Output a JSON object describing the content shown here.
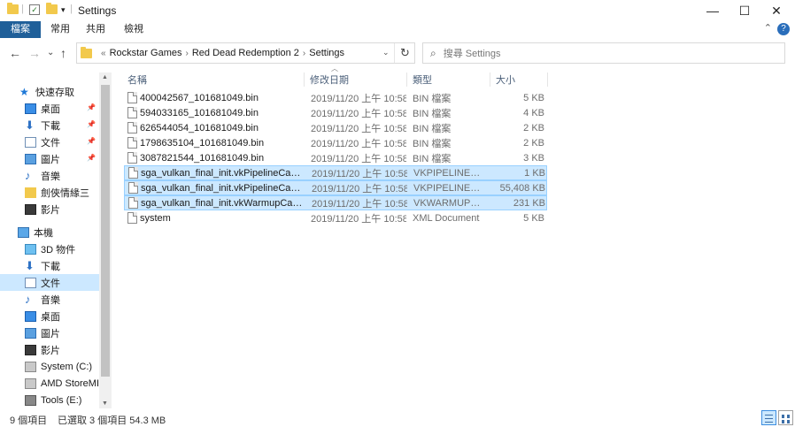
{
  "window": {
    "title": "Settings",
    "minimize": "—",
    "maximize": "☐",
    "close": "✕"
  },
  "ribbon": {
    "tabs": [
      "檔案",
      "常用",
      "共用",
      "檢視"
    ],
    "help": "?",
    "collapse": "⌃"
  },
  "address": {
    "overflow": "«",
    "crumbs": [
      "Rockstar Games",
      "Red Dead Redemption 2",
      "Settings"
    ],
    "separator": "›",
    "dropdown": "⌄",
    "refresh": "↻"
  },
  "search": {
    "placeholder": "搜尋 Settings"
  },
  "nav": {
    "back": "←",
    "forward": "→",
    "recent": "⌄",
    "up": "↑",
    "items": [
      {
        "label": "快速存取",
        "icon": "star-icon",
        "pinned": false
      },
      {
        "label": "桌面",
        "icon": "desktop-icon",
        "pinned": true
      },
      {
        "label": "下載",
        "icon": "download-icon",
        "pinned": true
      },
      {
        "label": "文件",
        "icon": "document-icon",
        "pinned": true
      },
      {
        "label": "圖片",
        "icon": "picture-icon",
        "pinned": true
      },
      {
        "label": "音樂",
        "icon": "music-icon",
        "pinned": false
      },
      {
        "label": "劍俠情緣三",
        "icon": "folder-icon",
        "pinned": false
      },
      {
        "label": "影片",
        "icon": "video-icon",
        "pinned": false
      },
      {
        "label": "本機",
        "icon": "computer-icon",
        "pinned": false
      },
      {
        "label": "3D 物件",
        "icon": "3d-objects-icon",
        "pinned": false
      },
      {
        "label": "下載",
        "icon": "download-icon",
        "pinned": false
      },
      {
        "label": "文件",
        "icon": "document-icon",
        "pinned": false
      },
      {
        "label": "音樂",
        "icon": "music-icon",
        "pinned": false
      },
      {
        "label": "桌面",
        "icon": "desktop-icon",
        "pinned": false
      },
      {
        "label": "圖片",
        "icon": "picture-icon",
        "pinned": false
      },
      {
        "label": "影片",
        "icon": "video-icon",
        "pinned": false
      },
      {
        "label": "System (C:)",
        "icon": "drive-icon",
        "pinned": false
      },
      {
        "label": "AMD StoreMI (",
        "icon": "drive-icon",
        "pinned": false
      },
      {
        "label": "Tools (E:)",
        "icon": "network-drive-icon",
        "pinned": false
      }
    ]
  },
  "columns": {
    "name": "名稱",
    "modified": "修改日期",
    "type": "類型",
    "size": "大小"
  },
  "files": [
    {
      "name": "400042567_101681049.bin",
      "modified": "2019/11/20 上午 10:58",
      "type": "BIN 檔案",
      "size": "5 KB",
      "selected": false
    },
    {
      "name": "594033165_101681049.bin",
      "modified": "2019/11/20 上午 10:58",
      "type": "BIN 檔案",
      "size": "4 KB",
      "selected": false
    },
    {
      "name": "626544054_101681049.bin",
      "modified": "2019/11/20 上午 10:58",
      "type": "BIN 檔案",
      "size": "2 KB",
      "selected": false
    },
    {
      "name": "1798635104_101681049.bin",
      "modified": "2019/11/20 上午 10:58",
      "type": "BIN 檔案",
      "size": "2 KB",
      "selected": false
    },
    {
      "name": "3087821544_101681049.bin",
      "modified": "2019/11/20 上午 10:58",
      "type": "BIN 檔案",
      "size": "3 KB",
      "selected": false
    },
    {
      "name": "sga_vulkan_final_init.vkPipelineCacheH...",
      "modified": "2019/11/20 上午 10:58",
      "type": "VKPIPELINECAC...",
      "size": "1 KB",
      "selected": true
    },
    {
      "name": "sga_vulkan_final_init.vkPipelineCache...",
      "modified": "2019/11/20 上午 10:58",
      "type": "VKPIPELINECAC...",
      "size": "55,408 KB",
      "selected": true
    },
    {
      "name": "sga_vulkan_final_init.vkWarmupCache...",
      "modified": "2019/11/20 上午 10:58",
      "type": "VKWARMUPCAC...",
      "size": "231 KB",
      "selected": true
    },
    {
      "name": "system",
      "modified": "2019/11/20 上午 10:58",
      "type": "XML Document",
      "size": "5 KB",
      "selected": false
    }
  ],
  "status": {
    "count": "9 個項目",
    "selection": "已選取 3 個項目  54.3 MB"
  }
}
